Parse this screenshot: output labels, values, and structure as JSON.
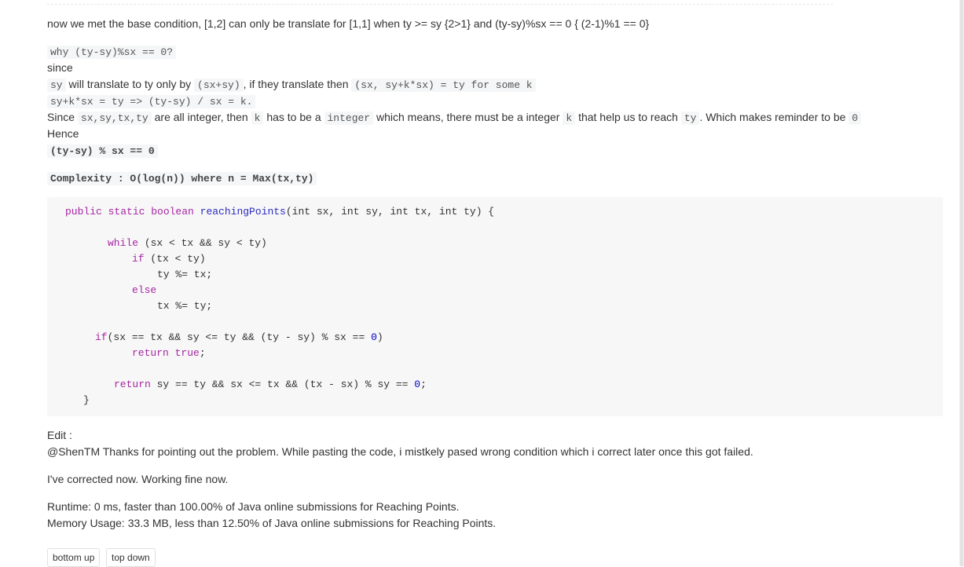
{
  "post": {
    "line1": "now we met the base condition, [1,2] can only be translate for [1,1] when ty >= sy {2>1} and (ty-sy)%sx == 0 { (2-1)%1 == 0}",
    "why_code": "why (ty-sy)%sx == 0?",
    "since": "since",
    "l4_code1": "sy",
    "l4_text1": "will translate to ty only by",
    "l4_code2": "(sx+sy)",
    "l4_text2": ", if they translate then",
    "l4_code3": "(sx, sy+k*sx) = ty for some k",
    "l5_code": "sy+k*sx = ty => (ty-sy) / sx = k.",
    "l6_t1": "Since",
    "l6_c1": "sx,sy,tx,ty",
    "l6_t2": "are all integer, then",
    "l6_c2": "k",
    "l6_t3": "has to be a",
    "l6_c3": "integer",
    "l6_t4": "which means, there must be a integer",
    "l6_c4": "k",
    "l6_t5": "that help us to reach",
    "l6_c5": "ty",
    "l6_t6": ". Which makes reminder to be",
    "l6_c6": "0",
    "hence": "Hence",
    "hence_code": "(ty-sy) % sx == 0",
    "complexity": "Complexity : O(log(n)) where n = Max(tx,ty)",
    "code": {
      "l1_kw": "public static boolean",
      "l1_fn": "reachingPoints",
      "l1_args": "(int sx, int sy, int tx, int ty) {",
      "l3_kw": "while",
      "l3_rest": " (sx < tx && sy < ty)",
      "l4_kw": "if",
      "l4_rest": " (tx < ty)",
      "l5": "ty %= tx;",
      "l6_kw": "else",
      "l7": "tx %= ty;",
      "l9_kw": "if",
      "l9_rest": "(sx == tx && sy <= ty && (ty - sy) % sx == ",
      "l9_num": "0",
      "l9_end": ")",
      "l10_kw": "return",
      "l10_val": " true",
      "l10_end": ";",
      "l12_kw": "return",
      "l12_rest": " sy == ty && sx <= tx && (tx - sx) % sy == ",
      "l12_num": "0",
      "l12_end": ";",
      "l13": "}"
    },
    "edit_label": "Edit :",
    "edit_text": "@ShenTM Thanks for pointing out the problem. While pasting the code, i mistkely pased wrong condition which i correct later once this got failed.",
    "corrected": "I've corrected now. Working fine now.",
    "runtime": "Runtime: 0 ms, faster than 100.00% of Java online submissions for Reaching Points.",
    "memory": "Memory Usage: 33.3 MB, less than 12.50% of Java online submissions for Reaching Points."
  },
  "tags": [
    "bottom up",
    "top down"
  ]
}
